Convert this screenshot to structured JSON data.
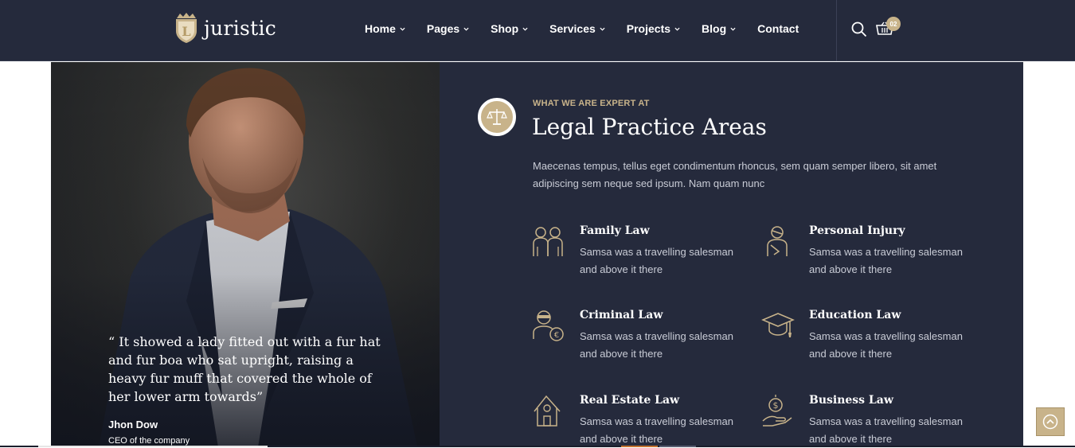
{
  "brand": {
    "name": "juristic",
    "logo_letter": "L"
  },
  "nav": {
    "items": [
      {
        "label": "Home"
      },
      {
        "label": "Pages"
      },
      {
        "label": "Shop"
      },
      {
        "label": "Services"
      },
      {
        "label": "Projects"
      },
      {
        "label": "Blog"
      },
      {
        "label": "Contact"
      }
    ],
    "cart_count": "02"
  },
  "testimonial": {
    "quote": "“ It showed a lady fitted out with a fur hat and fur boa who sat upright, raising a heavy fur muff that covered the whole of her lower arm towards”",
    "author": "Jhon Dow",
    "role": "CEO of the company"
  },
  "section": {
    "eyebrow": "WHAT WE ARE EXPERT AT",
    "title": "Legal Practice Areas",
    "description": "Maecenas tempus, tellus eget condimentum rhoncus, sem quam semper libero, sit amet adipiscing sem neque sed ipsum. Nam quam nunc"
  },
  "practices": [
    {
      "title": "Family Law",
      "text": "Samsa was a travelling salesman and above it there",
      "icon": "family-icon"
    },
    {
      "title": "Personal Injury",
      "text": "Samsa was a travelling salesman and above it there",
      "icon": "injury-icon"
    },
    {
      "title": "Criminal Law",
      "text": "Samsa was a travelling salesman and above it there",
      "icon": "criminal-icon"
    },
    {
      "title": "Education Law",
      "text": "Samsa was a travelling salesman and above it there",
      "icon": "graduation-cap-icon"
    },
    {
      "title": "Real Estate Law",
      "text": "Samsa was a travelling salesman and above it there",
      "icon": "house-icon"
    },
    {
      "title": "Business Law",
      "text": "Samsa was a travelling salesman and above it there",
      "icon": "money-hand-icon"
    }
  ],
  "colors": {
    "navy": "#252a3c",
    "gold": "#c8b38a",
    "text_muted": "#c9ccd6"
  }
}
